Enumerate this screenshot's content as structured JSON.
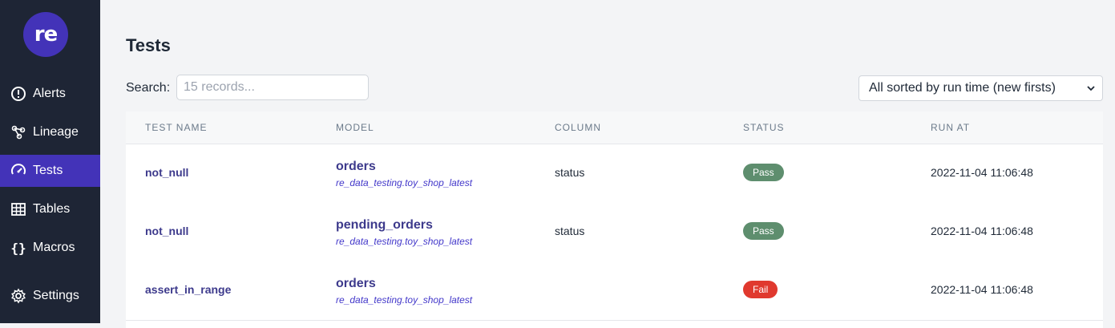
{
  "app": {
    "logo_text": "re",
    "accent": "#4333b8"
  },
  "sidebar": {
    "items": [
      {
        "label": "Alerts",
        "icon": "alert-circle-icon"
      },
      {
        "label": "Lineage",
        "icon": "lineage-icon"
      },
      {
        "label": "Tests",
        "icon": "gauge-icon",
        "active": true
      },
      {
        "label": "Tables",
        "icon": "table-icon"
      },
      {
        "label": "Macros",
        "icon": "braces-icon"
      },
      {
        "label": "Settings",
        "icon": "gear-icon"
      }
    ]
  },
  "page": {
    "title": "Tests",
    "search": {
      "label": "Search:",
      "placeholder": "15 records...",
      "value": ""
    },
    "sort": {
      "selected": "All sorted by run time (new firsts)"
    }
  },
  "table": {
    "columns": [
      "TEST NAME",
      "MODEL",
      "COLUMN",
      "STATUS",
      "RUN AT"
    ],
    "rows": [
      {
        "test_name": "not_null",
        "model": "orders",
        "model_path": "re_data_testing.toy_shop_latest",
        "column": "status",
        "status": "Pass",
        "run_at": "2022-11-04 11:06:48"
      },
      {
        "test_name": "not_null",
        "model": "pending_orders",
        "model_path": "re_data_testing.toy_shop_latest",
        "column": "status",
        "status": "Pass",
        "run_at": "2022-11-04 11:06:48"
      },
      {
        "test_name": "assert_in_range",
        "model": "orders",
        "model_path": "re_data_testing.toy_shop_latest",
        "column": "",
        "status": "Fail",
        "run_at": "2022-11-04 11:06:48"
      }
    ]
  },
  "colors": {
    "pass": "#5e8e6e",
    "fail": "#e0392e"
  }
}
